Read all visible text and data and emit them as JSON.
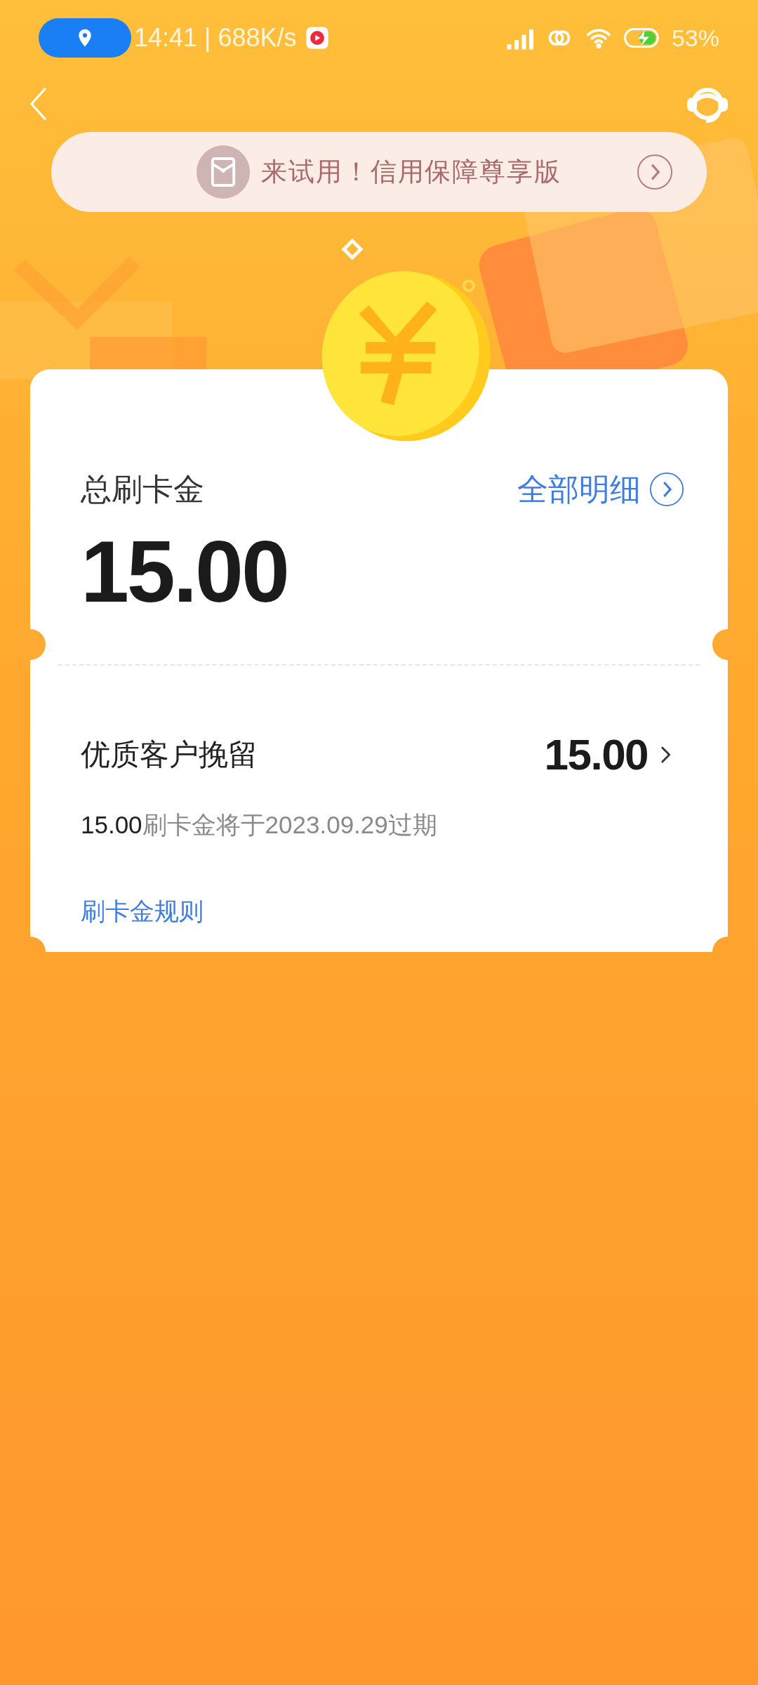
{
  "status_bar": {
    "time_speed": "14:41 | 688K/s",
    "battery": "53%"
  },
  "banner": {
    "text": "来试用！信用保障尊享版"
  },
  "summary": {
    "label": "总刷卡金",
    "link": "全部明细",
    "amount": "15.00"
  },
  "items": [
    {
      "name": "优质客户挽留",
      "amount": "15.00",
      "expiry_amount": "15.00",
      "expiry_text": "刷卡金将于2023.09.29过期"
    }
  ],
  "rules_link": "刷卡金规则"
}
